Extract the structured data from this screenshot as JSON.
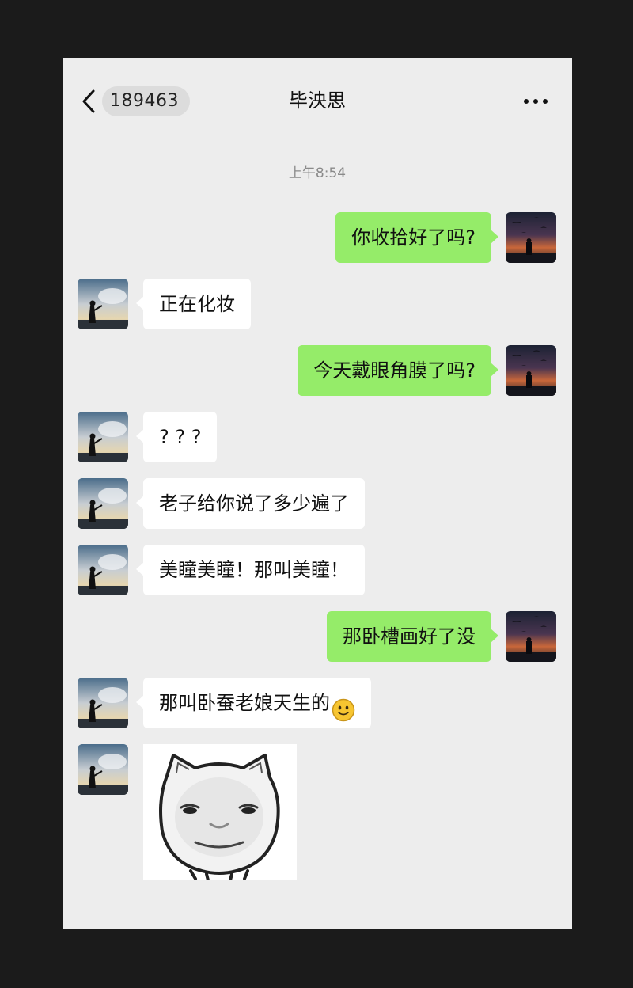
{
  "header": {
    "back_count": "189463",
    "title": "毕泱思",
    "more_icon": "more-dots-icon",
    "back_icon": "chevron-left-icon"
  },
  "timestamp": "上午8:54",
  "colors": {
    "sent_bubble": "#95ec69",
    "received_bubble": "#ffffff",
    "background": "#ededed"
  },
  "messages": [
    {
      "side": "right",
      "type": "text",
      "text": "你收拾好了吗?"
    },
    {
      "side": "left",
      "type": "text",
      "text": "正在化妆"
    },
    {
      "side": "right",
      "type": "text",
      "text": "今天戴眼角膜了吗?"
    },
    {
      "side": "left",
      "type": "text",
      "text": "? ? ?"
    },
    {
      "side": "left",
      "type": "text",
      "text": "老子给你说了多少遍了"
    },
    {
      "side": "left",
      "type": "text",
      "text": "美瞳美瞳！那叫美瞳！"
    },
    {
      "side": "right",
      "type": "text",
      "text": "那卧槽画好了没"
    },
    {
      "side": "left",
      "type": "text",
      "text": "那叫卧蚕老娘天生的",
      "emoji": "smile-emoji-icon"
    },
    {
      "side": "left",
      "type": "sticker",
      "sticker": "cat-face-sticker"
    }
  ]
}
